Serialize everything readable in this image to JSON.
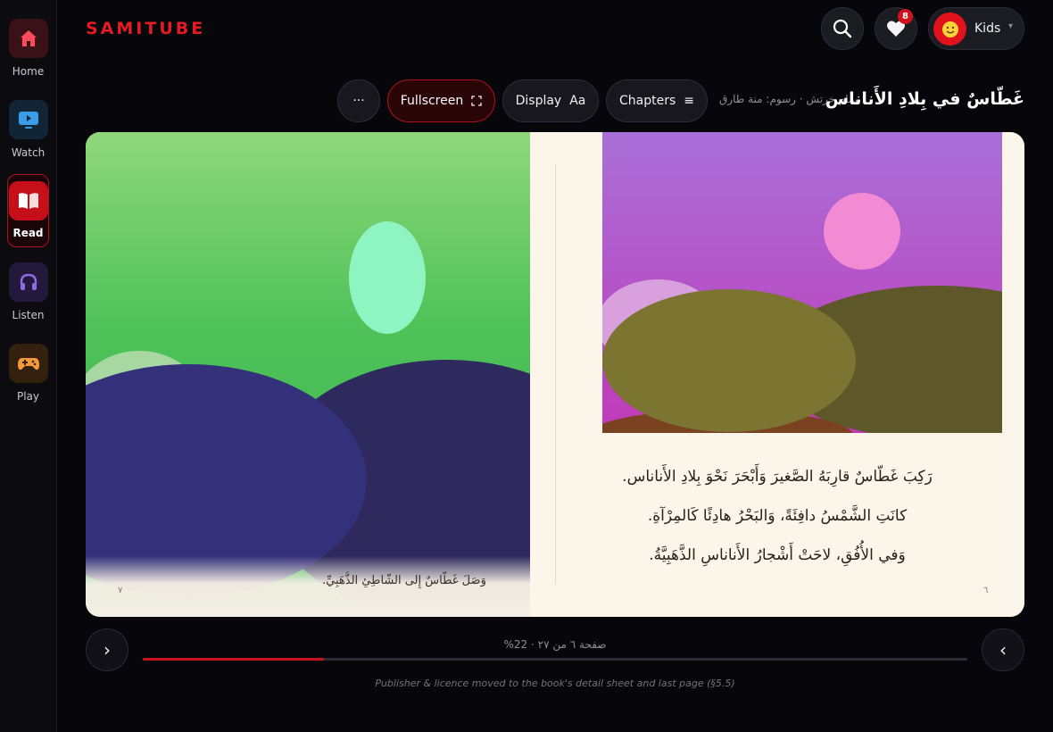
{
  "app": {
    "logo": "SAMITUBE",
    "accent": "#e31b23"
  },
  "sidebar": {
    "items": [
      {
        "label": "Home",
        "icon": "home-icon",
        "active": false,
        "tile_color": "#3a1116",
        "icon_color": "#ff4a5a"
      },
      {
        "label": "Watch",
        "icon": "tv-icon",
        "active": false,
        "tile_color": "#112537",
        "icon_color": "#3b9de8"
      },
      {
        "label": "Read",
        "icon": "open-book-icon",
        "active": true,
        "tile_color": "#c5101b",
        "icon_color": "#ffffff"
      },
      {
        "label": "Listen",
        "icon": "headphones-icon",
        "active": false,
        "tile_color": "#23193d",
        "icon_color": "#8a6ee8"
      },
      {
        "label": "Play",
        "icon": "gamepad-icon",
        "active": false,
        "tile_color": "#33200f",
        "icon_color": "#f29a3a"
      }
    ]
  },
  "header": {
    "favorites_count": "8",
    "profile_name": "Kids",
    "profile_caret": "▾",
    "avatar_emoji": "🙂"
  },
  "toolbar": {
    "more_label": "···",
    "fullscreen_label": "Fullscreen",
    "display_label": "Display",
    "display_glyph": "Aa",
    "chapters_label": "Chapters",
    "chapters_glyph": "≡",
    "book_title": "غَطّاسٌ في بِلادِ الأَناناس",
    "book_credit": "يمام خرتش · رسوم: منة طارق"
  },
  "reader": {
    "left_page": {
      "caption": "وَصَلَ غَطّاسٌ إِلى الشّاطِئِ الذَّهَبِيِّ.",
      "page_number": "٧"
    },
    "right_page": {
      "lines": [
        "رَكِبَ غَطّاسٌ قارِبَهُ الصَّغيرَ وَأَبْحَرَ نَحْوَ بِلادِ الأَناناس.",
        "كانَتِ الشَّمْسُ دافِئَةً، وَالبَحْرُ هادِئًا كَالمِرْآةِ.",
        "وَفي الأُفُقِ، لاحَتْ أَشْجارُ الأَناناسِ الذَّهَبِيَّةُ."
      ],
      "page_number": "٦"
    }
  },
  "progress": {
    "label": "صفحة ٦ من ٢٧ · 22%",
    "percent": 22
  },
  "footnote": "Publisher & licence moved to the book's detail sheet and last page (§5.5)",
  "nav": {
    "prev_glyph": "›",
    "next_glyph": "‹"
  }
}
